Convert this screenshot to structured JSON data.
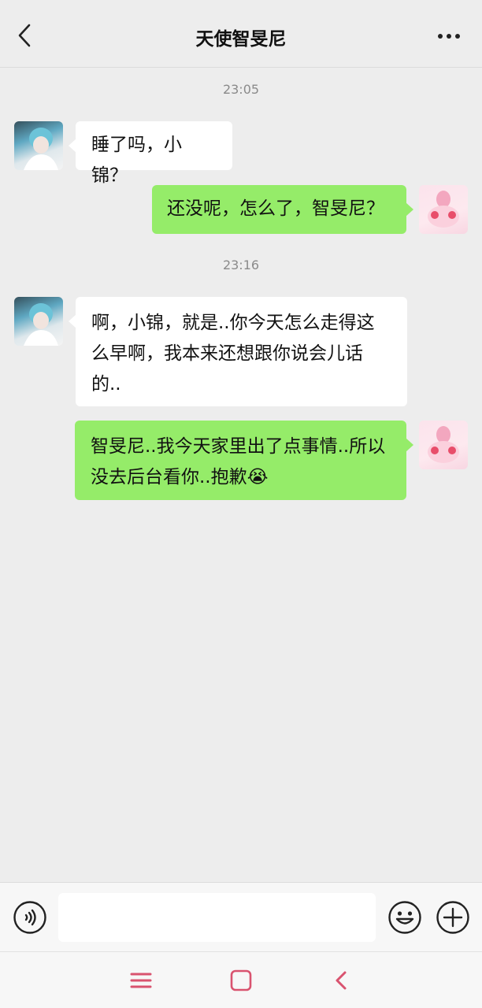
{
  "header": {
    "title": "天使智旻尼",
    "back_icon": "chevron-left-icon",
    "more_icon": "ellipsis-icon"
  },
  "messages": {
    "time1": "23:05",
    "msg1": "睡了吗，小锦？",
    "msg2": "还没呢，怎么了，智旻尼？",
    "time2": "23:16",
    "msg3": "啊，小锦，就是..你今天怎么走得这么早啊，我本来还想跟你说会儿话的..",
    "msg4": "智旻尼..我今天家里出了点事情..所以没去后台看你..抱歉😭"
  },
  "input_bar": {
    "voice_icon": "voice-icon",
    "placeholder": "",
    "emoji_icon": "emoji-icon",
    "plus_icon": "plus-icon"
  },
  "system_nav": {
    "menu_icon": "menu-icon",
    "home_icon": "home-icon",
    "back_icon": "back-icon"
  },
  "colors": {
    "background": "#ededed",
    "outgoing_bubble": "#95ec69",
    "incoming_bubble": "#ffffff",
    "nav_icon": "#d9536f"
  }
}
